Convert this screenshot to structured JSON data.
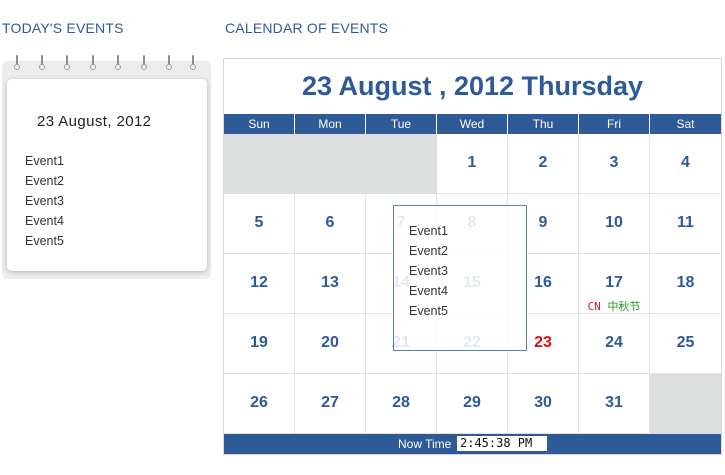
{
  "today_section": {
    "title": "TODAY'S  EVENTS",
    "date": "23 August, 2012",
    "events": [
      "Event1",
      "Event2",
      "Event3",
      "Event4",
      "Event5"
    ]
  },
  "calendar_section": {
    "title": "CALENDAR OF EVENTS",
    "heading": "23 August , 2012 Thursday",
    "weekdays": [
      "Sun",
      "Mon",
      "Tue",
      "Wed",
      "Thu",
      "Fri",
      "Sat"
    ],
    "today": "23",
    "first_weekday_index": 3,
    "days_in_month": 31,
    "festival": {
      "day": "17",
      "tag": "CN",
      "name": "中秋节"
    },
    "popup_events": [
      "Event1",
      "Event2",
      "Event3",
      "Event4",
      "Event5"
    ],
    "now_time_label": "Now Time",
    "now_time_value": "2:45:38 PM"
  },
  "colors": {
    "accent": "#2e5a97",
    "today": "#e01010",
    "empty_cell": "#dde0de",
    "festival_tag": "#cc2222",
    "festival_name": "#229922"
  }
}
